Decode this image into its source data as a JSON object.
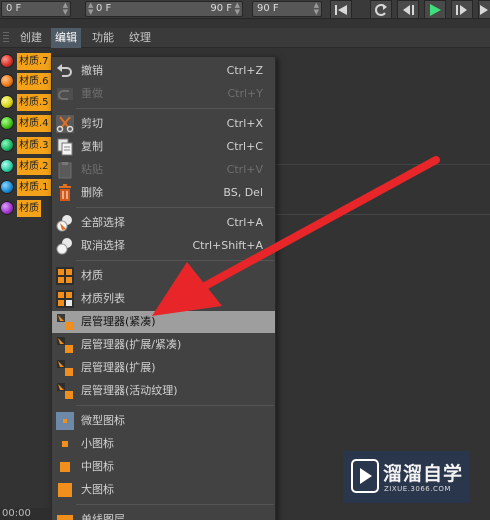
{
  "timeline": {
    "field1_value": "0 F",
    "field2_value": "0 F",
    "field2_end": "90 F",
    "field3_value": "90 F"
  },
  "menubar": {
    "items": [
      "创建",
      "编辑",
      "功能",
      "纹理"
    ]
  },
  "materials": [
    {
      "label": "材质.7",
      "color": "#d9332b"
    },
    {
      "label": "材质.6",
      "color": "#ee7a1a"
    },
    {
      "label": "材质.5",
      "color": "#d9d61c"
    },
    {
      "label": "材质.4",
      "color": "#46c41c"
    },
    {
      "label": "材质.3",
      "color": "#1fb86a"
    },
    {
      "label": "材质.2",
      "color": "#2fd0a6"
    },
    {
      "label": "材质.1",
      "color": "#1c8fd6"
    },
    {
      "label": "材质",
      "color": "#a43ad1"
    }
  ],
  "menu": {
    "undo": {
      "label": "撤销",
      "shortcut": "Ctrl+Z"
    },
    "redo": {
      "label": "重做",
      "shortcut": "Ctrl+Y"
    },
    "cut": {
      "label": "剪切",
      "shortcut": "Ctrl+X"
    },
    "copy": {
      "label": "复制",
      "shortcut": "Ctrl+C"
    },
    "paste": {
      "label": "粘贴",
      "shortcut": "Ctrl+V"
    },
    "delete": {
      "label": "删除",
      "shortcut": "BS, Del"
    },
    "select_all": {
      "label": "全部选择",
      "shortcut": "Ctrl+A"
    },
    "deselect": {
      "label": "取消选择",
      "shortcut": "Ctrl+Shift+A"
    },
    "materials": {
      "label": "材质"
    },
    "material_list": {
      "label": "材质列表"
    },
    "layer_compact": {
      "label": "层管理器(紧凑)"
    },
    "layer_expand_compact": {
      "label": "层管理器(扩展/紧凑)"
    },
    "layer_expand": {
      "label": "层管理器(扩展)"
    },
    "layer_active_texture": {
      "label": "层管理器(活动纹理)"
    },
    "tiny_icons": {
      "label": "微型图标"
    },
    "small_icons": {
      "label": "小图标"
    },
    "medium_icons": {
      "label": "中图标"
    },
    "large_icons": {
      "label": "大图标"
    },
    "single_line": {
      "label": "单线图层"
    }
  },
  "bottom_time": "00:00",
  "watermark": {
    "title": "溜溜自学",
    "url": "ZIXUE.3066.COM"
  },
  "accent": "#f08f1c",
  "highlight": "#9e9e9e",
  "arrow_color": "#e8262a"
}
